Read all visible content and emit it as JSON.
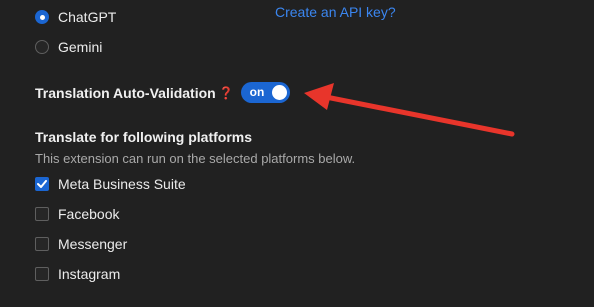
{
  "provider": {
    "options": [
      {
        "label": "ChatGPT",
        "selected": true
      },
      {
        "label": "Gemini",
        "selected": false
      }
    ],
    "api_link": "Create an API key?"
  },
  "auto_validation": {
    "label": "Translation Auto-Validation",
    "help_icon": "help-question-icon",
    "toggle_label": "on",
    "enabled": true
  },
  "platforms": {
    "title": "Translate for following platforms",
    "description": "This extension can run on the selected platforms below.",
    "items": [
      {
        "label": "Meta Business Suite",
        "checked": true
      },
      {
        "label": "Facebook",
        "checked": false
      },
      {
        "label": "Messenger",
        "checked": false
      },
      {
        "label": "Instagram",
        "checked": false
      }
    ]
  },
  "colors": {
    "background": "#212121",
    "accent": "#1b66d2",
    "link": "#3b86f0",
    "annotation_arrow": "#e8352b"
  }
}
